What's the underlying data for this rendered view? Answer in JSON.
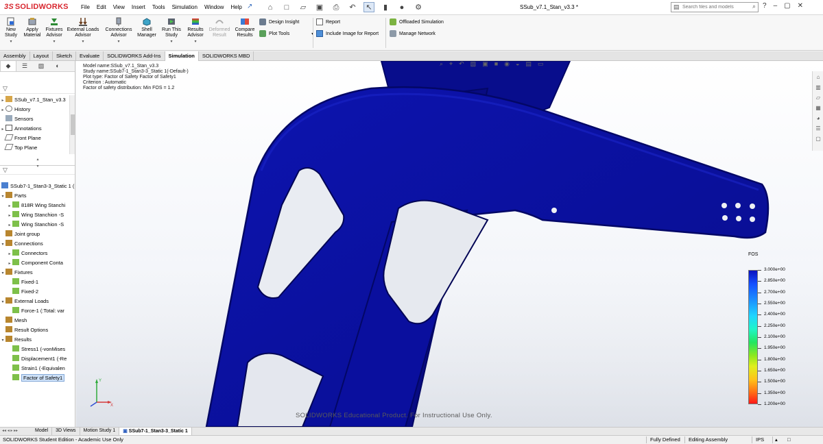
{
  "app": {
    "logo_text": "SOLIDWORKS",
    "logo_mark": "3S",
    "menus": [
      "File",
      "Edit",
      "View",
      "Insert",
      "Tools",
      "Simulation",
      "Window",
      "Help"
    ],
    "document_title": "SSub_v7.1_Stan_v3.3 *",
    "search_placeholder": "Search files and models",
    "window_controls": [
      "?",
      "–",
      "▢",
      "✕"
    ]
  },
  "ribbon": {
    "big_buttons": [
      {
        "label": "New\nStudy",
        "icon": "new-study-icon"
      },
      {
        "label": "Apply\nMaterial",
        "icon": "apply-material-icon"
      },
      {
        "label": "Fixtures\nAdvisor",
        "icon": "fixtures-icon"
      },
      {
        "label": "External Loads\nAdvisor",
        "icon": "external-loads-icon"
      },
      {
        "label": "Connections\nAdvisor",
        "icon": "connections-icon"
      },
      {
        "label": "Shell\nManager",
        "icon": "shell-manager-icon"
      },
      {
        "label": "Run This\nStudy",
        "icon": "run-study-icon"
      },
      {
        "label": "Results\nAdvisor",
        "icon": "results-advisor-icon"
      },
      {
        "label": "Deformed\nResult",
        "icon": "deformed-result-icon",
        "disabled": true
      },
      {
        "label": "Compare\nResults",
        "icon": "compare-results-icon"
      }
    ],
    "small_buttons_col1": [
      "Design Insight",
      "Plot Tools"
    ],
    "small_buttons_col2": [
      "Report",
      "Include Image for Report"
    ],
    "small_buttons_col3": [
      "Offloaded Simulation",
      "Manage Network"
    ]
  },
  "tabs": [
    "Assembly",
    "Layout",
    "Sketch",
    "Evaluate",
    "SOLIDWORKS Add-Ins",
    "Simulation",
    "SOLIDWORKS MBD"
  ],
  "active_tab": "Simulation",
  "feature_tree": {
    "root": "SSub_v7.1_Stan_v3.3",
    "items": [
      "History",
      "Sensors",
      "Annotations",
      "Front Plane",
      "Top Plane"
    ]
  },
  "study_tree": {
    "root": "SSub7-1_Stan3-3_Static 1 (-",
    "rows": [
      {
        "label": "Parts",
        "level": 0,
        "expand": "▾"
      },
      {
        "label": "818R Wing Stanchi",
        "level": 1,
        "expand": "▸"
      },
      {
        "label": "Wing Stanchion -S",
        "level": 1,
        "expand": "▸"
      },
      {
        "label": "Wing Stanchion -S",
        "level": 1,
        "expand": "▸"
      },
      {
        "label": "Joint group",
        "level": 0,
        "expand": ""
      },
      {
        "label": "Connections",
        "level": 0,
        "expand": "▾"
      },
      {
        "label": "Connectors",
        "level": 1,
        "expand": "▸"
      },
      {
        "label": "Component Conta",
        "level": 1,
        "expand": "▸"
      },
      {
        "label": "Fixtures",
        "level": 0,
        "expand": "▾"
      },
      {
        "label": "Fixed-1",
        "level": 1,
        "expand": ""
      },
      {
        "label": "Fixed-2",
        "level": 1,
        "expand": ""
      },
      {
        "label": "External Loads",
        "level": 0,
        "expand": "▾"
      },
      {
        "label": "Force-1 (:Total: var",
        "level": 1,
        "expand": ""
      },
      {
        "label": "Mesh",
        "level": 0,
        "expand": ""
      },
      {
        "label": "Result Options",
        "level": 0,
        "expand": ""
      },
      {
        "label": "Results",
        "level": 0,
        "expand": "▾"
      },
      {
        "label": "Stress1 (-vonMises",
        "level": 1,
        "expand": ""
      },
      {
        "label": "Displacement1 (-Re",
        "level": 1,
        "expand": ""
      },
      {
        "label": "Strain1 (-Equivalen",
        "level": 1,
        "expand": ""
      },
      {
        "label": "Factor of Safety1",
        "level": 1,
        "expand": "",
        "selected": true
      }
    ]
  },
  "plot_info": {
    "line1": "Model name:SSub_v7.1_Stan_v3.3",
    "line2": "Study name:SSub7-1_Stan3-3_Static 1(-Default-)",
    "line3": "Plot type: Factor of Safety Factor of Safety1",
    "line4": "Criterion : Automatic",
    "line5": "Factor of safety distribution: Min FOS = 1.2"
  },
  "legend": {
    "title": "FOS",
    "ticks": [
      "3.000e+00",
      "2.850e+00",
      "2.700e+00",
      "2.550e+00",
      "2.400e+00",
      "2.250e+00",
      "2.100e+00",
      "1.950e+00",
      "1.800e+00",
      "1.650e+00",
      "1.500e+00",
      "1.350e+00",
      "1.200e+00"
    ]
  },
  "watermark": "SOLIDWORKS Educational Product. For Instructional Use Only.",
  "bottom_tabs": [
    "Model",
    "3D Views",
    "Motion Study 1",
    "SSub7-1_Stan3-3_Static 1"
  ],
  "bottom_active": "SSub7-1_Stan3-3_Static 1",
  "status": {
    "left": "SOLIDWORKS Student Edition - Academic Use Only",
    "defined": "Fully Defined",
    "mode": "Editing Assembly",
    "units": "IPS"
  },
  "colors": {
    "model_fill": "#0a0f9e",
    "model_edge": "#030766",
    "brand_red": "#d8262e"
  }
}
